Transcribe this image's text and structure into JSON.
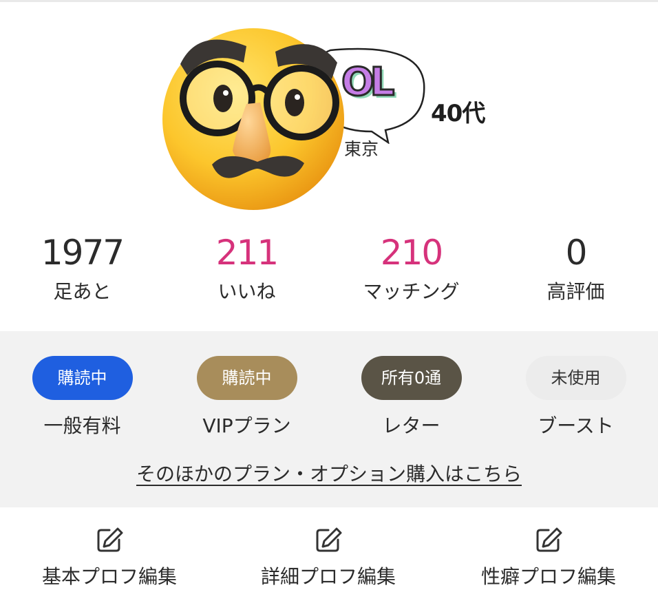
{
  "profile": {
    "age": "40代",
    "area": "東京",
    "bubble_text": "OL",
    "avatar_icon": "disguise-face-emoji"
  },
  "stats": [
    {
      "value": "1977",
      "label": "足あと",
      "color": "#2b2b2b"
    },
    {
      "value": "211",
      "label": "いいね",
      "color": "#d6327b"
    },
    {
      "value": "210",
      "label": "マッチング",
      "color": "#d6327b"
    },
    {
      "value": "0",
      "label": "高評価",
      "color": "#2b2b2b"
    }
  ],
  "plans": [
    {
      "badge": "購読中",
      "label": "一般有料",
      "bg": "#1f5fe0",
      "fg": "#ffffff"
    },
    {
      "badge": "購読中",
      "label": "VIPプラン",
      "bg": "#a88d5b",
      "fg": "#ffffff"
    },
    {
      "badge": "所有0通",
      "label": "レター",
      "bg": "#5a5446",
      "fg": "#ffffff"
    },
    {
      "badge": "未使用",
      "label": "ブースト",
      "bg": "#ececec",
      "fg": "#333333"
    }
  ],
  "more_link": "そのほかのプラン・オプション購入はこちら",
  "edit_buttons": [
    {
      "label": "基本プロフ編集",
      "icon": "edit-icon"
    },
    {
      "label": "詳細プロフ編集",
      "icon": "edit-icon"
    },
    {
      "label": "性癖プロフ編集",
      "icon": "edit-icon"
    }
  ]
}
